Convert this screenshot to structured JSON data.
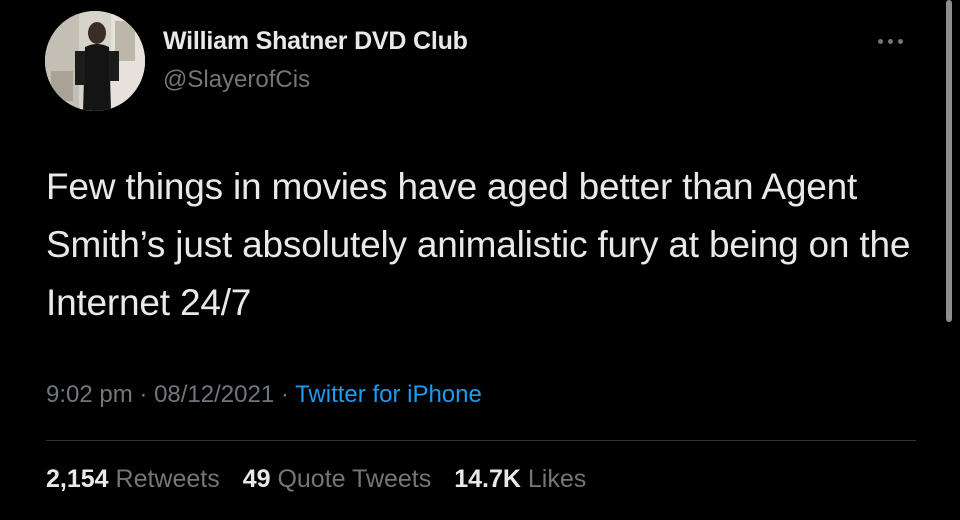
{
  "author": {
    "display_name": "William Shatner DVD Club",
    "handle": "@SlayerofCis"
  },
  "tweet": {
    "text": "Few things in movies have aged better than Agent Smith’s just absolutely animalistic fury at being on the Internet 24/7",
    "time": "9:02 pm",
    "date": "08/12/2021",
    "source": "Twitter for iPhone",
    "separator": "·"
  },
  "stats": {
    "retweets_count": "2,154",
    "retweets_label": "Retweets",
    "quotes_count": "49",
    "quotes_label": "Quote Tweets",
    "likes_count": "14.7K",
    "likes_label": "Likes"
  },
  "icons": {
    "more": "more-horizontal-icon"
  },
  "colors": {
    "background": "#000000",
    "primary_text": "#e7e9ea",
    "secondary_text": "#71767b",
    "link": "#1d9bf0",
    "divider": "#2f3336"
  }
}
